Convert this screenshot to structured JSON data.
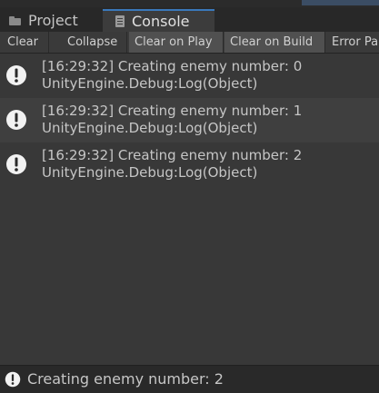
{
  "tabs": [
    {
      "label": "Project",
      "icon": "folder-icon",
      "active": false
    },
    {
      "label": "Console",
      "icon": "console-icon",
      "active": true
    }
  ],
  "toolbar": {
    "clear": "Clear",
    "collapse": "Collapse",
    "clear_on_play": "Clear on Play",
    "clear_on_build": "Clear on Build",
    "error_pause": "Error Pause"
  },
  "logs": [
    {
      "message": "[16:29:32] Creating enemy number: 0",
      "trace": "UnityEngine.Debug:Log(Object)",
      "icon": "info-icon"
    },
    {
      "message": "[16:29:32] Creating enemy number: 1",
      "trace": "UnityEngine.Debug:Log(Object)",
      "icon": "info-icon"
    },
    {
      "message": "[16:29:32] Creating enemy number: 2",
      "trace": "UnityEngine.Debug:Log(Object)",
      "icon": "info-icon"
    }
  ],
  "status": {
    "text": "Creating enemy number: 2",
    "icon": "info-icon"
  },
  "colors": {
    "active_tab_accent": "#3a79bb",
    "panel_bg": "#383838",
    "toggle_on_bg": "#505050"
  }
}
